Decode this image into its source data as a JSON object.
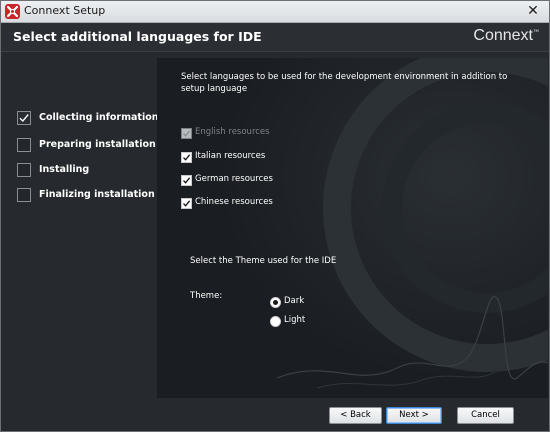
{
  "window": {
    "title": "Connext Setup",
    "close_glyph": "✕"
  },
  "header": {
    "title": "Select additional languages for IDE",
    "brand": "Connext",
    "brand_mark": "™"
  },
  "steps": [
    {
      "label": "Collecting information",
      "checked": true
    },
    {
      "label": "Preparing installation",
      "checked": false
    },
    {
      "label": "Installing",
      "checked": false
    },
    {
      "label": "Finalizing installation",
      "checked": false
    }
  ],
  "languages": {
    "intro": "Select languages to be used for the development environment in addition to setup language",
    "items": [
      {
        "label": "English resources",
        "checked": true,
        "disabled": true
      },
      {
        "label": "Italian resources",
        "checked": true,
        "disabled": false
      },
      {
        "label": "German resources",
        "checked": true,
        "disabled": false
      },
      {
        "label": "Chinese resources",
        "checked": true,
        "disabled": false
      }
    ]
  },
  "theme": {
    "title": "Select the Theme used for the IDE",
    "label": "Theme:",
    "options": [
      {
        "label": "Dark",
        "selected": true
      },
      {
        "label": "Light",
        "selected": false
      }
    ]
  },
  "buttons": {
    "back": "< Back",
    "next": "Next >",
    "cancel": "Cancel"
  },
  "icons": {
    "app": "connext-logo-icon",
    "check": "checkmark-icon"
  },
  "colors": {
    "background": "#262a2e",
    "panel": "#1a1d21",
    "text": "#ffffff",
    "disabled_text": "#7e8286",
    "app_icon": "#c8262b"
  }
}
